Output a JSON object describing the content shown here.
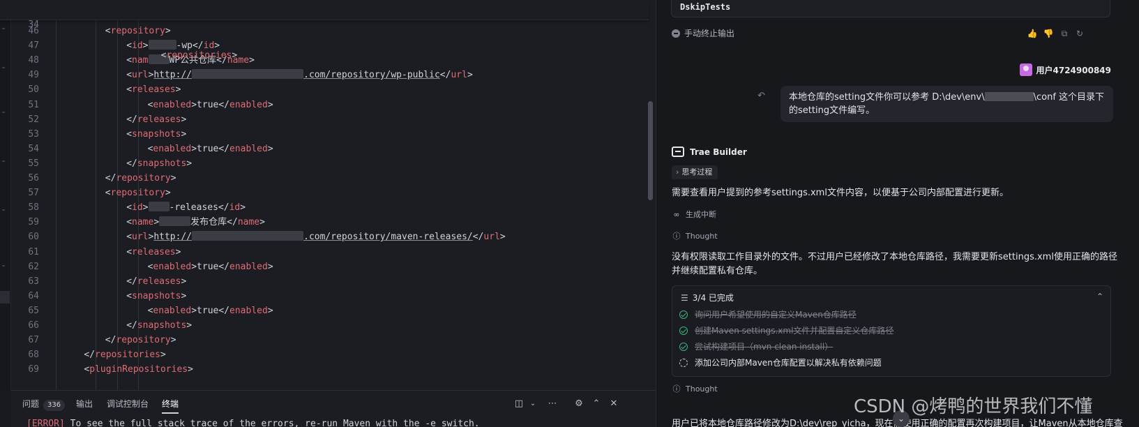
{
  "editor": {
    "sticky": {
      "num": "34",
      "code": "<repositories>"
    },
    "lines": [
      {
        "num": "46",
        "indent": 4,
        "parts": [
          [
            "pun",
            "<"
          ],
          [
            "tag",
            "repository"
          ],
          [
            "pun",
            ">"
          ]
        ]
      },
      {
        "num": "47",
        "indent": 6,
        "parts": [
          [
            "pun",
            "<"
          ],
          [
            "tag",
            "id"
          ],
          [
            "pun",
            ">"
          ],
          [
            "blur",
            "40"
          ],
          [
            "txt",
            "-wp</"
          ],
          [
            "tag",
            "id"
          ],
          [
            "pun",
            ">"
          ]
        ]
      },
      {
        "num": "48",
        "indent": 6,
        "parts": [
          [
            "pun",
            "<"
          ],
          [
            "tag",
            "nam"
          ],
          [
            "blur",
            "30"
          ],
          [
            "txt",
            "WP公共仓库</"
          ],
          [
            "tag",
            "name"
          ],
          [
            "pun",
            ">"
          ]
        ]
      },
      {
        "num": "49",
        "indent": 6,
        "parts": [
          [
            "pun",
            "<"
          ],
          [
            "tag",
            "url"
          ],
          [
            "pun",
            ">"
          ],
          [
            "url",
            "http://"
          ],
          [
            "blur",
            "160"
          ],
          [
            "url",
            ".com/repository/wp-public"
          ],
          [
            "pun",
            "</"
          ],
          [
            "tag",
            "url"
          ],
          [
            "pun",
            ">"
          ]
        ]
      },
      {
        "num": "50",
        "indent": 6,
        "parts": [
          [
            "pun",
            "<"
          ],
          [
            "tag",
            "releases"
          ],
          [
            "pun",
            ">"
          ]
        ]
      },
      {
        "num": "51",
        "indent": 8,
        "parts": [
          [
            "pun",
            "<"
          ],
          [
            "tag",
            "enabled"
          ],
          [
            "pun",
            ">"
          ],
          [
            "txt",
            "true</"
          ],
          [
            "tag",
            "enabled"
          ],
          [
            "pun",
            ">"
          ]
        ]
      },
      {
        "num": "52",
        "indent": 6,
        "parts": [
          [
            "pun",
            "</"
          ],
          [
            "tag",
            "releases"
          ],
          [
            "pun",
            ">"
          ]
        ]
      },
      {
        "num": "53",
        "indent": 6,
        "parts": [
          [
            "pun",
            "<"
          ],
          [
            "tag",
            "snapshots"
          ],
          [
            "pun",
            ">"
          ]
        ]
      },
      {
        "num": "54",
        "indent": 8,
        "parts": [
          [
            "pun",
            "<"
          ],
          [
            "tag",
            "enabled"
          ],
          [
            "pun",
            ">"
          ],
          [
            "txt",
            "true</"
          ],
          [
            "tag",
            "enabled"
          ],
          [
            "pun",
            ">"
          ]
        ]
      },
      {
        "num": "55",
        "indent": 6,
        "parts": [
          [
            "pun",
            "</"
          ],
          [
            "tag",
            "snapshots"
          ],
          [
            "pun",
            ">"
          ]
        ]
      },
      {
        "num": "56",
        "indent": 4,
        "parts": [
          [
            "pun",
            "</"
          ],
          [
            "tag",
            "repository"
          ],
          [
            "pun",
            ">"
          ]
        ]
      },
      {
        "num": "57",
        "indent": 4,
        "parts": [
          [
            "pun",
            "<"
          ],
          [
            "tag",
            "repository"
          ],
          [
            "pun",
            ">"
          ]
        ]
      },
      {
        "num": "58",
        "indent": 6,
        "parts": [
          [
            "pun",
            "<"
          ],
          [
            "tag",
            "id"
          ],
          [
            "pun",
            ">"
          ],
          [
            "blur",
            "30"
          ],
          [
            "txt",
            "-releases</"
          ],
          [
            "tag",
            "id"
          ],
          [
            "pun",
            ">"
          ]
        ]
      },
      {
        "num": "59",
        "indent": 6,
        "parts": [
          [
            "pun",
            "<"
          ],
          [
            "tag",
            "name"
          ],
          [
            "pun",
            ">"
          ],
          [
            "blur",
            "45"
          ],
          [
            "txt",
            "发布仓库</"
          ],
          [
            "tag",
            "name"
          ],
          [
            "pun",
            ">"
          ]
        ]
      },
      {
        "num": "60",
        "indent": 6,
        "parts": [
          [
            "pun",
            "<"
          ],
          [
            "tag",
            "url"
          ],
          [
            "pun",
            ">"
          ],
          [
            "url",
            "http://"
          ],
          [
            "blur",
            "160"
          ],
          [
            "url",
            ".com/repository/maven-releases/"
          ],
          [
            "pun",
            "</"
          ],
          [
            "tag",
            "url"
          ],
          [
            "pun",
            ">"
          ]
        ]
      },
      {
        "num": "61",
        "indent": 6,
        "parts": [
          [
            "pun",
            "<"
          ],
          [
            "tag",
            "releases"
          ],
          [
            "pun",
            ">"
          ]
        ]
      },
      {
        "num": "62",
        "indent": 8,
        "parts": [
          [
            "pun",
            "<"
          ],
          [
            "tag",
            "enabled"
          ],
          [
            "pun",
            ">"
          ],
          [
            "txt",
            "true</"
          ],
          [
            "tag",
            "enabled"
          ],
          [
            "pun",
            ">"
          ]
        ]
      },
      {
        "num": "63",
        "indent": 6,
        "parts": [
          [
            "pun",
            "</"
          ],
          [
            "tag",
            "releases"
          ],
          [
            "pun",
            ">"
          ]
        ]
      },
      {
        "num": "64",
        "indent": 6,
        "parts": [
          [
            "pun",
            "<"
          ],
          [
            "tag",
            "snapshots"
          ],
          [
            "pun",
            ">"
          ]
        ]
      },
      {
        "num": "65",
        "indent": 8,
        "parts": [
          [
            "pun",
            "<"
          ],
          [
            "tag",
            "enabled"
          ],
          [
            "pun",
            ">"
          ],
          [
            "txt",
            "true</"
          ],
          [
            "tag",
            "enabled"
          ],
          [
            "pun",
            ">"
          ]
        ]
      },
      {
        "num": "66",
        "indent": 6,
        "parts": [
          [
            "pun",
            "</"
          ],
          [
            "tag",
            "snapshots"
          ],
          [
            "pun",
            ">"
          ]
        ]
      },
      {
        "num": "67",
        "indent": 4,
        "parts": [
          [
            "pun",
            "</"
          ],
          [
            "tag",
            "repository"
          ],
          [
            "pun",
            ">"
          ]
        ]
      },
      {
        "num": "68",
        "indent": 2,
        "parts": [
          [
            "pun",
            "</"
          ],
          [
            "tag",
            "repositories"
          ],
          [
            "pun",
            ">"
          ]
        ]
      },
      {
        "num": "69",
        "indent": 2,
        "parts": [
          [
            "pun",
            "<"
          ],
          [
            "tag",
            "pluginRepositories"
          ],
          [
            "pun",
            ">"
          ]
        ]
      }
    ]
  },
  "bottom_panel": {
    "tabs": {
      "problems": "问题",
      "problems_count": "336",
      "output": "输出",
      "debug_console": "调试控制台",
      "terminal": "终端"
    },
    "terminal_line_tag": "[ERROR]",
    "terminal_line_text": " To see the full stack trace of the errors, re-run Maven with the -e switch."
  },
  "chat": {
    "cmd_text": "DskipTests",
    "stop_label": "手动终止输出",
    "user_name": "用户4724900849",
    "user_message_a": "本地仓库的setting文件你可以参考 D:\\dev\\env\\",
    "user_message_b": "\\conf 这个目录下的setting文件编写。",
    "bot_name": "Trae Builder",
    "thinking_label": "思考过程",
    "para1": "需要查看用户提到的参考settings.xml文件内容，以便基于公司内部配置进行更新。",
    "status_interrupted": "生成中断",
    "thought_label": "Thought",
    "para2": "没有权限读取工作目录外的文件。不过用户已经修改了本地仓库路径，我需要更新settings.xml使用正确的路径并继续配置私有仓库。",
    "task_header": "3/4 已完成",
    "tasks": [
      "询问用户希望使用的自定义Maven仓库路径",
      "创建Maven settings.xml文件并配置自定义仓库路径",
      "尝试构建项目（mvn clean install）",
      "添加公司内部Maven仓库配置以解决私有依赖问题"
    ],
    "thought_label_2": "Thought",
    "last_para": "用户已将本地仓库路径修改为D:\\dev\\rep_yicha，现在需使用正确的配置再次构建项目，让Maven从本地仓库查"
  },
  "watermark": "CSDN @烤鸭的世界我们不懂"
}
